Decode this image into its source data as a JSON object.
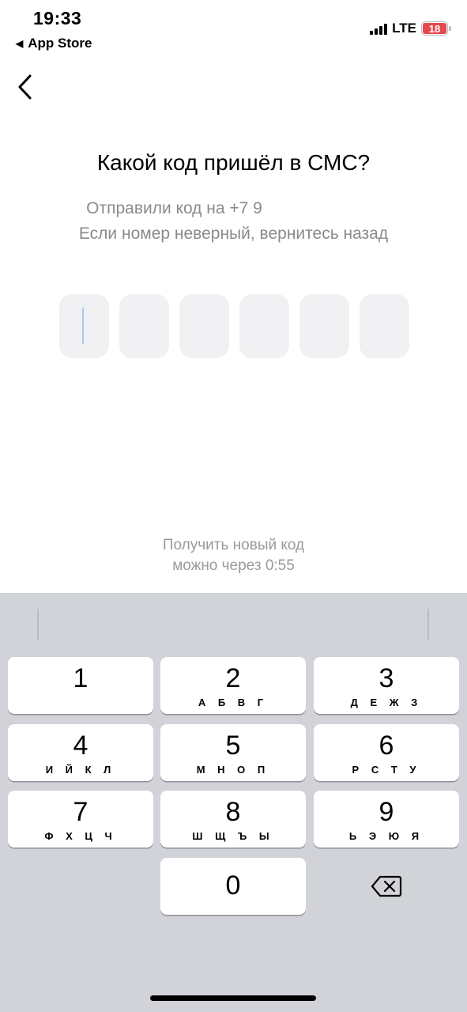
{
  "status_bar": {
    "time": "19:33",
    "back_app": "App Store",
    "network": "LTE",
    "battery": "18",
    "battery_color": "#e5484d"
  },
  "nav": {
    "back_icon": "chevron-left-icon"
  },
  "header": {
    "title": "Какой код пришёл в СМС?",
    "sent_to": "Отправили код на +7 9",
    "hint": "Если номер неверный, вернитесь назад"
  },
  "code_input": {
    "length": 6,
    "active_index": 0
  },
  "resend": {
    "line1": "Получить новый код",
    "line2": "можно через 0:55"
  },
  "keyboard": {
    "keys": [
      {
        "num": "1",
        "letters": ""
      },
      {
        "num": "2",
        "letters": "А Б В Г"
      },
      {
        "num": "3",
        "letters": "Д Е Ж З"
      },
      {
        "num": "4",
        "letters": "И Й К Л"
      },
      {
        "num": "5",
        "letters": "М Н О П"
      },
      {
        "num": "6",
        "letters": "Р С Т У"
      },
      {
        "num": "7",
        "letters": "Ф Х Ц Ч"
      },
      {
        "num": "8",
        "letters": "Ш Щ Ъ Ы"
      },
      {
        "num": "9",
        "letters": "Ь Э Ю Я"
      },
      {
        "num": "0",
        "letters": ""
      }
    ],
    "delete_icon": "backspace-icon"
  }
}
